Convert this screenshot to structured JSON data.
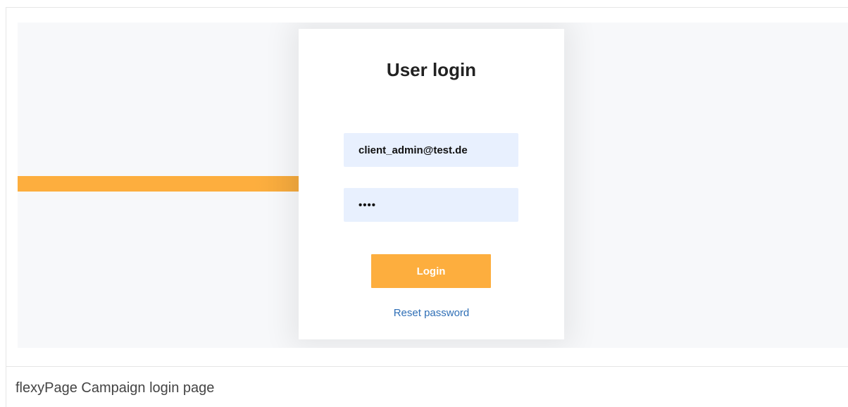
{
  "login": {
    "title": "User login",
    "email_value": "client_admin@test.de",
    "password_value": "••••",
    "login_label": "Login",
    "reset_label": "Reset password"
  },
  "caption": "flexyPage Campaign login page",
  "colors": {
    "accent": "#fdae3e",
    "input_bg": "#e8f0fe",
    "link": "#2f6fb6",
    "stage_bg": "#f7f8fa"
  }
}
